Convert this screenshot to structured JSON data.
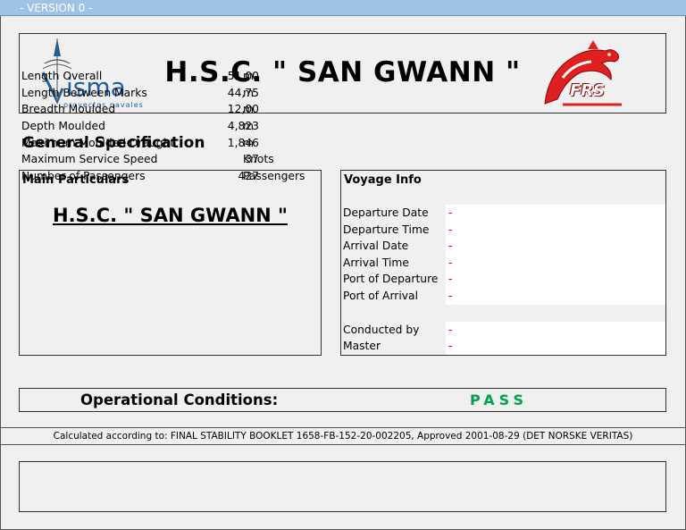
{
  "version_label": "- VERSION  0 -",
  "header": {
    "title": "H.S.C. \" SAN GWANN \"",
    "left_logo": {
      "icon": "visma-logo",
      "word": "isma",
      "tagline": "proyectos navales"
    },
    "right_logo": {
      "icon": "frs-dolphin-logo",
      "word": "FRS"
    }
  },
  "section_title": "General Specification",
  "main_particulars": {
    "title": "Main Particulars",
    "ship_name": "H.S.C. \" SAN GWANN \"",
    "rows": [
      {
        "label": "Length Overall",
        "value": "51,00",
        "unit": "m"
      },
      {
        "label": "Length Between Marks",
        "value": "44,75",
        "unit": "m"
      },
      {
        "label": "Breadth Moulded",
        "value": "12,00",
        "unit": "m"
      },
      {
        "label": "Depth Moulded",
        "value": "4,823",
        "unit": "m"
      },
      {
        "label": "Maximum Moulded Draught",
        "value": "1,846",
        "unit": "m"
      },
      {
        "label": "Maximum Service Speed",
        "value": "37",
        "unit": "Knots"
      },
      {
        "label": "Number of Passengers",
        "value": "427",
        "unit": "Passengers"
      }
    ]
  },
  "voyage_info": {
    "title": "Voyage Info",
    "rows": [
      {
        "label": "Departure Date",
        "value": "-"
      },
      {
        "label": "Departure Time",
        "value": "-"
      },
      {
        "label": "Arrival Date",
        "value": "-"
      },
      {
        "label": "Arrival Time",
        "value": "-"
      },
      {
        "label": "Port of Departure",
        "value": "-"
      },
      {
        "label": "Port of Arrival",
        "value": "-"
      }
    ],
    "crew_rows": [
      {
        "label": "Conducted by",
        "value": "-"
      },
      {
        "label": "Master",
        "value": "-"
      }
    ]
  },
  "operational": {
    "label": "Operational Conditions:",
    "status": "PASS",
    "status_color": "#00a050"
  },
  "calculation_note": "Calculated according to: FINAL STABILITY BOOKLET 1658-FB-152-20-002205, Approved 2001-08-29 (DET NORSKE VERITAS)",
  "colors": {
    "version_bar": "#9dc3e6",
    "value_dash": "#c00000",
    "visma_blue": "#1f5fa0",
    "frs_red": "#e02020"
  }
}
